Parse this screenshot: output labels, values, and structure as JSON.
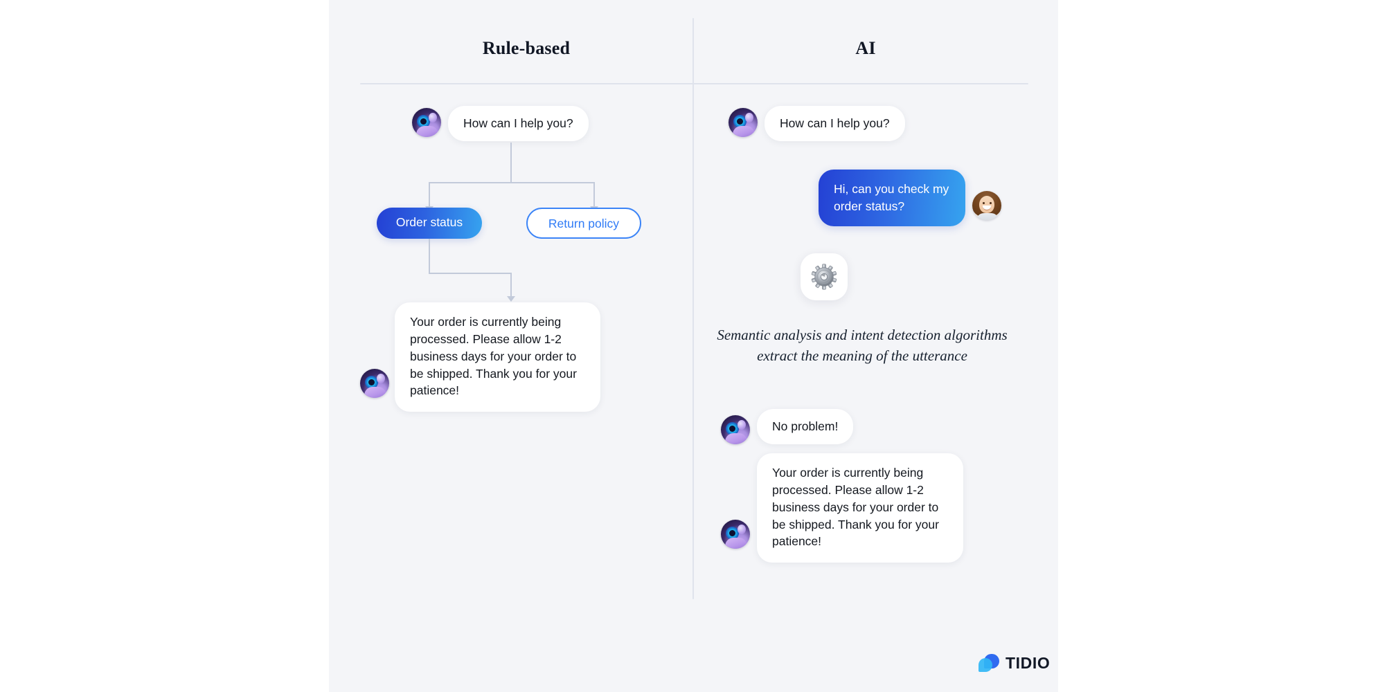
{
  "columns": {
    "left_title": "Rule-based",
    "right_title": "AI"
  },
  "rule_based": {
    "greeting": "How can I help you?",
    "option_order_status": "Order status",
    "option_return_policy": "Return policy",
    "answer": "Your order is currently being processed. Please allow 1-2 business days for your order to be shipped. Thank you for your patience!"
  },
  "ai": {
    "greeting": "How can I help you?",
    "user_question": "Hi, can you check my order status?",
    "processing_icon": "gear-icon",
    "caption": "Semantic analysis and intent detection algorithms extract the meaning of the utterance",
    "acknowledgement": "No problem!",
    "answer": "Your order is currently being processed. Please allow 1-2 business days for your order to be shipped. Thank you for your patience!"
  },
  "brand": {
    "name": "TIDIO"
  },
  "colors": {
    "canvas_bg": "#f4f5f8",
    "page_bg": "#ffffff",
    "divider": "#dfe3ec",
    "connector": "#c2cada",
    "accent_blue_dark": "#2441d4",
    "accent_blue_light": "#36a3ef",
    "outline_blue": "#3b84f7",
    "text_primary": "#14181f"
  }
}
